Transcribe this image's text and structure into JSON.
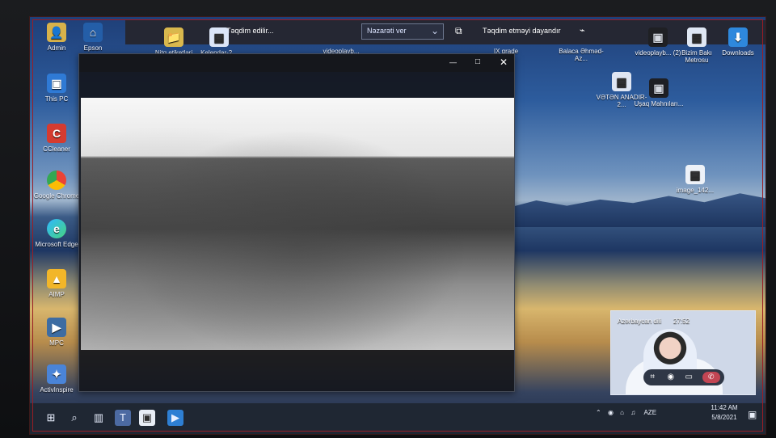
{
  "desktop": {
    "left_icons": [
      {
        "label": "Admin"
      },
      {
        "label": "Epson"
      },
      {
        "label": "This PC"
      },
      {
        "label": "CCleaner"
      },
      {
        "label": "Google Chrome"
      },
      {
        "label": "Microsoft Edge"
      },
      {
        "label": "AIMP"
      },
      {
        "label": "MPC"
      },
      {
        "label": "ActivInspire"
      }
    ],
    "top_icons": [
      {
        "label": "Nitq etiketləri"
      },
      {
        "label": "Kelendar-2..."
      },
      {
        "label": "videoplayb..."
      },
      {
        "label": "IX grade"
      },
      {
        "label": "Balaca\nƏhməd-Az..."
      },
      {
        "label": "videoplayb...\n(2)"
      },
      {
        "label": "Bizim Bakı\nMetrosu"
      },
      {
        "label": "Downloads"
      },
      {
        "label": "VƏTƏN\nANADIR-2..."
      },
      {
        "label": "Uşaq\nMahnıları..."
      },
      {
        "label": "image_142..."
      }
    ]
  },
  "toolbar": {
    "presenting_text": "Təqdim edilir...",
    "dropdown": "Nəzarəti ver",
    "stop_presenting": "Təqdim etməyi dayandır"
  },
  "meeting": {
    "name": "Azərbaycan dili",
    "time": "27:52"
  },
  "taskbar": {
    "language": "AZE",
    "time": "11:42 AM",
    "date": "5/8/2021"
  }
}
